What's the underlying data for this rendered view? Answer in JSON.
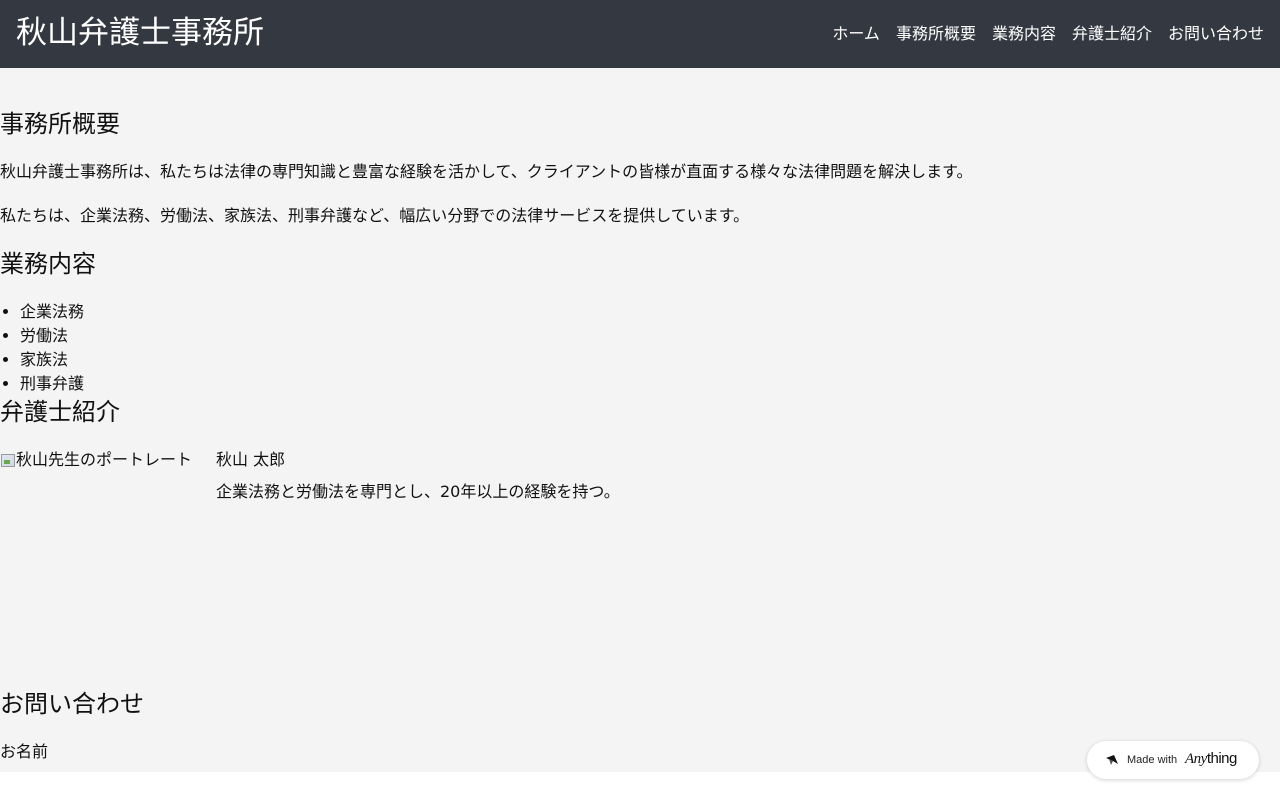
{
  "header": {
    "title": "秋山弁護士事務所",
    "nav": [
      "ホーム",
      "事務所概要",
      "業務内容",
      "弁護士紹介",
      "お問い合わせ"
    ]
  },
  "about": {
    "title": "事務所概要",
    "paragraphs": [
      "秋山弁護士事務所は、私たちは法律の専門知識と豊富な経験を活かして、クライアントの皆様が直面する様々な法律問題を解決します。",
      "私たちは、企業法務、労働法、家族法、刑事弁護など、幅広い分野での法律サービスを提供しています。"
    ]
  },
  "services": {
    "title": "業務内容",
    "items": [
      "企業法務",
      "労働法",
      "家族法",
      "刑事弁護"
    ]
  },
  "lawyers": {
    "title": "弁護士紹介",
    "items": [
      {
        "portrait_alt": "秋山先生のポートレート",
        "name": "秋山 太郎",
        "description": "企業法務と労働法を専門とし、20年以上の経験を持つ。"
      }
    ]
  },
  "contact": {
    "title": "お問い合わせ",
    "name_label": "お名前"
  },
  "badge": {
    "made_with": "Made with",
    "brand_a": "Any",
    "brand_b": "thing"
  },
  "colors": {
    "header_bg": "#343841",
    "page_bg": "#f4f4f4"
  }
}
